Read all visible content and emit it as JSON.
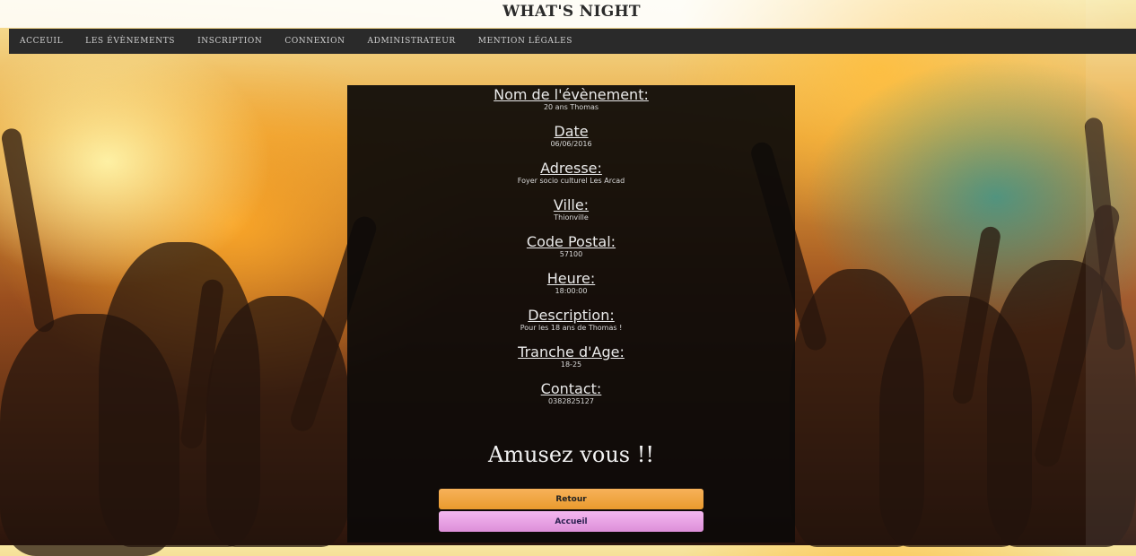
{
  "site": {
    "title": "WHAT'S NIGHT"
  },
  "nav": {
    "items": [
      {
        "label": "ACCEUIL"
      },
      {
        "label": "LES ÉVÈNEMENTS"
      },
      {
        "label": "INSCRIPTION"
      },
      {
        "label": "CONNEXION"
      },
      {
        "label": "ADMINISTRATEUR"
      },
      {
        "label": "MENTION LÉGALES"
      }
    ]
  },
  "event": {
    "name": {
      "label": "Nom de l'évènement:",
      "value": "20 ans Thomas"
    },
    "date": {
      "label": "Date",
      "value": "06/06/2016"
    },
    "address": {
      "label": "Adresse:",
      "value": "Foyer socio culturel Les Arcad"
    },
    "city": {
      "label": "Ville:",
      "value": "Thionville"
    },
    "postal": {
      "label": "Code Postal:",
      "value": "57100"
    },
    "time": {
      "label": "Heure:",
      "value": "18:00:00"
    },
    "description": {
      "label": "Description:",
      "value": "Pour les 18 ans de Thomas !"
    },
    "age": {
      "label": "Tranche d'Age:",
      "value": "18-25"
    },
    "contact": {
      "label": "Contact:",
      "value": "0382825127"
    }
  },
  "tagline": "Amusez vous !!",
  "buttons": {
    "retour": "Retour",
    "accueil": "Accueil"
  },
  "colors": {
    "retour": "#f0a640",
    "accueil": "#e9a3e4",
    "navbar": "#2a2a2a"
  }
}
